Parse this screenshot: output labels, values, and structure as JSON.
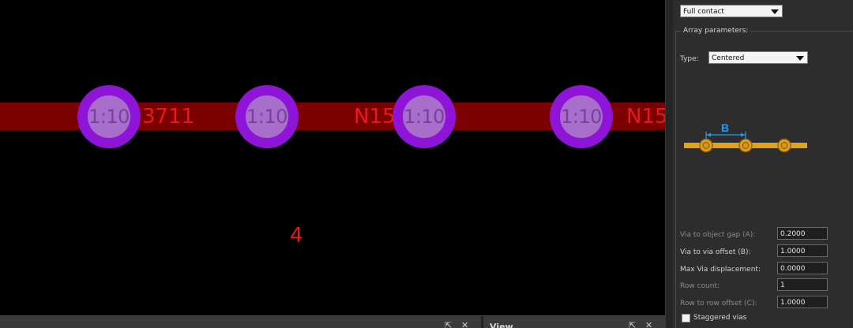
{
  "canvas": {
    "vias": [
      {
        "label": "1:10"
      },
      {
        "label": "1:10"
      },
      {
        "label": "1:10"
      },
      {
        "label": "1:10"
      }
    ],
    "net_labels": [
      "3711",
      "N15",
      "N15"
    ],
    "pad_number": "4",
    "colors": {
      "background": "#000000",
      "trace": "#7d0000",
      "via_ring": "#8e15d8",
      "via_hole": "#a76fc9",
      "net_text": "#e51b1b"
    }
  },
  "bottom_strip": {
    "left_controls": [
      "⇱",
      "✕"
    ],
    "view_title": "View",
    "right_controls": [
      "⇱",
      "✕"
    ]
  },
  "panel": {
    "contact_combo": {
      "value": "Full contact"
    },
    "array_parameters": {
      "title": "Array parameters:",
      "type_label": "Type:",
      "type_value": "Centered",
      "diagram": {
        "offset_label": "B",
        "colors": {
          "track": "#e2a21c",
          "pad_ring": "#c98f12",
          "dimension": "#2b9be8"
        }
      },
      "fields": [
        {
          "label": "Via to object gap (A):",
          "value": "0.2000",
          "dim": true
        },
        {
          "label": "Via to via offset (B):",
          "value": "1.0000",
          "dim": false
        },
        {
          "label": "Max Via displacement:",
          "value": "0.0000",
          "dim": false
        },
        {
          "label": "Row count:",
          "value": "1",
          "dim": true
        },
        {
          "label": "Row to row offset (C):",
          "value": "1.0000",
          "dim": true
        }
      ],
      "staggered_label": "Staggered vias",
      "staggered_checked": false
    }
  }
}
